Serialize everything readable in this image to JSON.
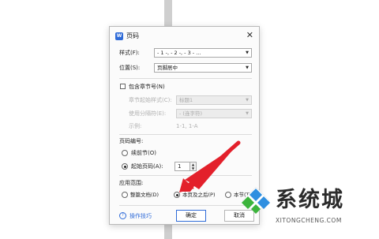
{
  "dialog": {
    "title": "页码",
    "app_icon_label": "W",
    "format_label": "样式(F):",
    "format_value": "- 1 -, - 2 -, - 3 - ...",
    "position_label": "位置(S):",
    "position_value": "页脚居中",
    "include_chapter_label": "包含章节号(N)",
    "chapter_style_label": "章节起始样式(C):",
    "chapter_style_value": "标题1",
    "separator_label": "使用分隔符(E):",
    "separator_value": "- (连字符)",
    "example_label": "示例:",
    "example_value": "1-1, 1-A",
    "numbering_heading": "页码编号:",
    "continue_label": "续前节(O)",
    "start_at_label": "起始页码(A):",
    "start_at_value": "1",
    "apply_heading": "应用范围:",
    "apply_options": [
      "整篇文档(D)",
      "本页及之后(P)",
      "本节(T)"
    ],
    "tips_label": "操作技巧",
    "ok_label": "确定",
    "cancel_label": "取消"
  },
  "watermark": {
    "brand": "系统城",
    "url": "XITONGCHENG.COM"
  },
  "colors": {
    "accent": "#2f6bd8",
    "arrow": "#e3202b",
    "logo_blue": "#2f8fe0",
    "logo_green": "#3cb43c"
  },
  "icons": {
    "app": "wps-writer-icon",
    "close": "close-icon",
    "tips": "tips-icon",
    "select_caret": "caret-down-icon",
    "arrow": "red-arrow-annotation"
  }
}
